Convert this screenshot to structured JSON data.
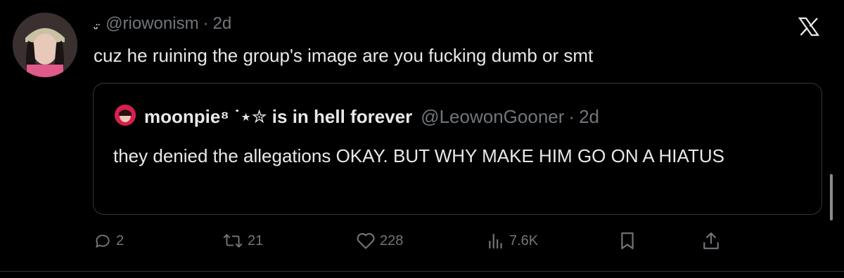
{
  "tweet": {
    "display_name": "ᵕ̈",
    "handle": "@riowonism",
    "separator": "·",
    "time": "2d",
    "text": "cuz he ruining the group's image are you fucking dumb or smt"
  },
  "quote": {
    "name": "moonpie⁸ ˙⋆✮ is in hell forever",
    "handle": "@LeowonGooner",
    "separator": "·",
    "time": "2d",
    "text": "they denied the allegations OKAY. BUT WHY MAKE HIM GO ON A HIATUS"
  },
  "actions": {
    "replies": "2",
    "reposts": "21",
    "likes": "228",
    "views": "7.6K"
  },
  "icons": {
    "close": "x-logo-icon",
    "reply": "reply-icon",
    "repost": "repost-icon",
    "like": "heart-icon",
    "views": "views-icon",
    "bookmark": "bookmark-icon",
    "share": "share-icon"
  },
  "colors": {
    "background": "#000000",
    "text": "#e7e9ea",
    "muted": "#71767b",
    "border": "#333639"
  }
}
